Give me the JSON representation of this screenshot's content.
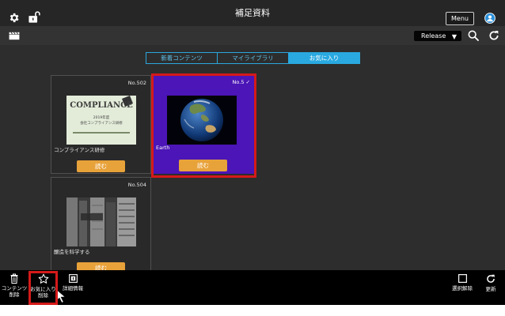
{
  "header": {
    "title": "補足資料",
    "menu_label": "Menu",
    "icons": [
      "gear-icon",
      "unlock-icon",
      "user-icon"
    ]
  },
  "subbar": {
    "release_label": "Release",
    "icons": [
      "clapperboard-icon",
      "search-icon",
      "refresh-icon"
    ]
  },
  "tabs": [
    {
      "label": "新着コンテンツ",
      "active": false
    },
    {
      "label": "マイライブラリ",
      "active": false
    },
    {
      "label": "お気に入り",
      "active": true
    }
  ],
  "cards": [
    {
      "number": "No.502",
      "caption": "コンプライアンス研修",
      "button": "読む",
      "selected": false,
      "thumb_text": [
        "COMPLIANCE",
        "2019年度",
        "会社コンプライアンス研修"
      ]
    },
    {
      "number": "No.5",
      "caption": "Earth",
      "button": "読む",
      "selected": true
    },
    {
      "number": "No.504",
      "caption": "醸造を科学する",
      "button": "読む",
      "selected": false
    }
  ],
  "toolbar": {
    "delete_label": "コンテンツ削除",
    "unfavorite_label": "お気に入り削除",
    "info_label": "詳細情報",
    "deselect_label": "選択解除",
    "refresh_label": "更新"
  },
  "colors": {
    "header_bg": "#262626",
    "content_bg": "#2d2d2d",
    "tab_accent": "#29a9e0",
    "read_button": "#e8a23a",
    "selected_card": "#4b15b7",
    "highlight": "#d51a1a"
  }
}
